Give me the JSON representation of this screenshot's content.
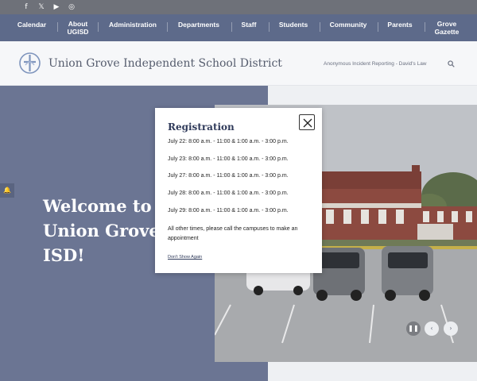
{
  "social": {
    "icons": [
      {
        "name": "facebook-icon",
        "glyph": "f"
      },
      {
        "name": "x-icon",
        "glyph": "𝕏"
      },
      {
        "name": "youtube-icon",
        "glyph": "▶"
      },
      {
        "name": "instagram-icon",
        "glyph": "◎"
      }
    ]
  },
  "nav": {
    "items": [
      {
        "label": "Calendar"
      },
      {
        "label": "About UGISD"
      },
      {
        "label": "Administration"
      },
      {
        "label": "Departments"
      },
      {
        "label": "Staff"
      },
      {
        "label": "Students"
      },
      {
        "label": "Community"
      },
      {
        "label": "Parents"
      },
      {
        "label": "Grove Gazette"
      }
    ]
  },
  "header": {
    "site_title": "Union Grove Independent School District",
    "incident_link": "Anonymous Incident Reporting - David's Law"
  },
  "hero": {
    "welcome_text": "Welcome to Union Grove ISD!"
  },
  "modal": {
    "title": "Registration",
    "schedule": [
      "July 22: 8:00 a.m. - 11:00 & 1:00 a.m. - 3:00 p.m.",
      "July 23: 8:00 a.m. - 11:00 & 1:00 a.m. - 3:00 p.m.",
      "July 27: 8:00 a.m. - 11:00 & 1:00 a.m. - 3:00 p.m.",
      "July 28: 8:00 a.m. - 11:00 & 1:00 a.m. - 3:00 p.m.",
      "July 29: 8:00 a.m. - 11:00 & 1:00 a.m. - 3:00 p.m."
    ],
    "note": "All other times, please call the campuses to make an appointment",
    "dont_show": "Don't Show Again"
  },
  "colors": {
    "nav_bg": "#5d6a8a",
    "social_bar_bg": "#6e7179",
    "hero_left_bg": "#6b7593",
    "modal_title": "#2f3a5a"
  }
}
